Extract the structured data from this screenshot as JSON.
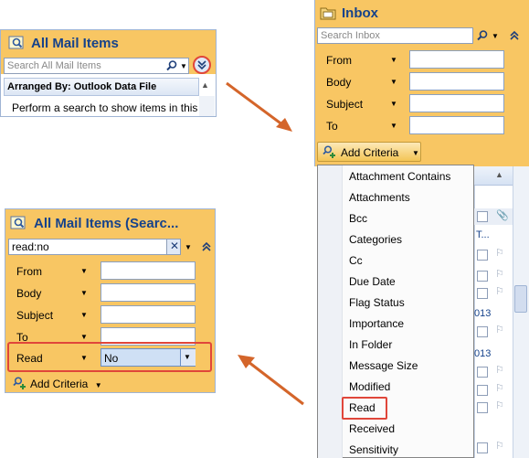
{
  "top_left": {
    "title": "All Mail Items",
    "search_placeholder": "Search All Mail Items",
    "arranged_by": "Arranged By: Outlook Data File",
    "message": "Perform a search to show items in this"
  },
  "bottom_left": {
    "title": "All Mail Items (Searc...",
    "search_value": "read:no",
    "criteria": [
      {
        "label": "From",
        "value": ""
      },
      {
        "label": "Body",
        "value": ""
      },
      {
        "label": "Subject",
        "value": ""
      },
      {
        "label": "To",
        "value": ""
      }
    ],
    "read_label": "Read",
    "read_value": "No",
    "add_criteria": "Add Criteria"
  },
  "right": {
    "title": "Inbox",
    "search_placeholder": "Search Inbox",
    "criteria": [
      {
        "label": "From"
      },
      {
        "label": "Body"
      },
      {
        "label": "Subject"
      },
      {
        "label": "To"
      }
    ],
    "add_criteria": "Add Criteria",
    "menu_items": [
      "Attachment Contains",
      "Attachments",
      "Bcc",
      "Categories",
      "Cc",
      "Due Date",
      "Flag Status",
      "Importance",
      "In Folder",
      "Message Size",
      "Modified",
      "Read",
      "Received",
      "Sensitivity"
    ],
    "list_fragments": [
      "T...",
      "013",
      "013"
    ]
  },
  "colors": {
    "panel": "#f8c663",
    "title": "#15428b",
    "highlight": "#e0463a",
    "arrow": "#d4652a"
  }
}
